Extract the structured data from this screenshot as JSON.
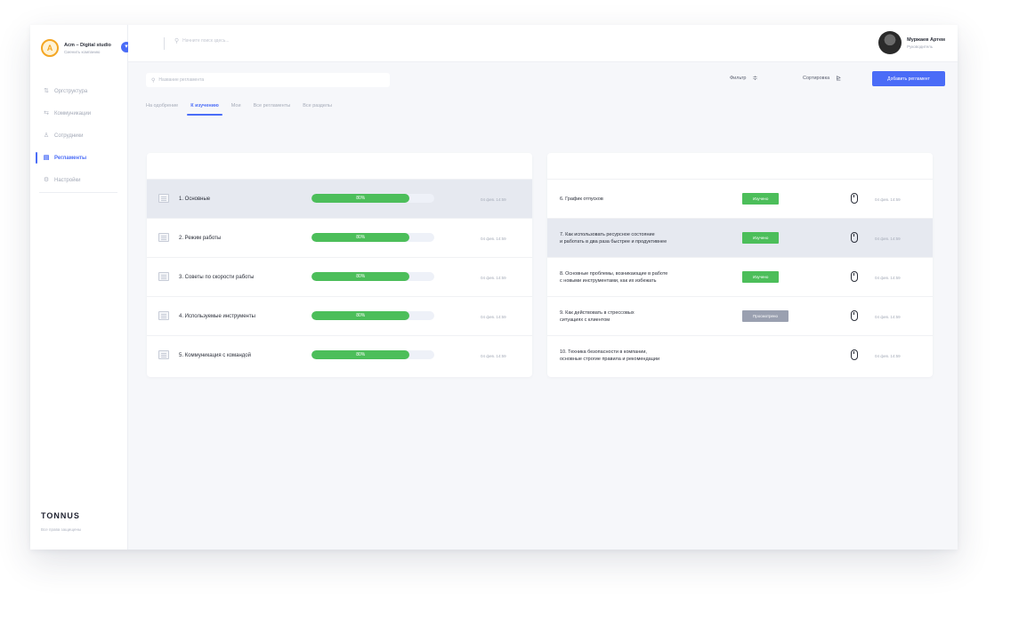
{
  "workspace": {
    "logo_letter": "A",
    "name": "Acm – Digital studio",
    "subtitle": "Сменить компанию",
    "toggle_icon": "chevron-down-icon"
  },
  "sidebar": {
    "items": [
      {
        "label": "Оргструктура",
        "icon": "org-structure-icon",
        "glyph": "⇅",
        "active": false
      },
      {
        "label": "Коммуникации",
        "icon": "communications-icon",
        "glyph": "⇆",
        "active": false
      },
      {
        "label": "Сотрудники",
        "icon": "employees-icon",
        "glyph": "♙",
        "active": false
      },
      {
        "label": "Регламенты",
        "icon": "regulations-icon",
        "glyph": "▤",
        "active": true
      },
      {
        "label": "Настройки",
        "icon": "settings-icon",
        "glyph": "⚙",
        "active": false
      }
    ],
    "brand": "TONNUS",
    "brand_sub": "Все права защищены"
  },
  "topbar": {
    "search_placeholder": "Начните поиск здесь...",
    "user_name": "Муржаев Артем",
    "user_role": "Руководитель"
  },
  "toolbar": {
    "search_placeholder": "Название регламента",
    "filter_label": "Фильтр",
    "sort_label": "Сортировка",
    "add_button": "Добавить регламент"
  },
  "tabs": [
    {
      "label": "На одобрение",
      "active": false
    },
    {
      "label": "К изучению",
      "active": true
    },
    {
      "label": "Мои",
      "active": false
    },
    {
      "label": "Все регламенты",
      "active": false
    },
    {
      "label": "Все разделы",
      "active": false
    }
  ],
  "documents": [
    {
      "title": "1. Основные",
      "progress_label": "80%",
      "progress": 80,
      "date": "04 фев. 14:59",
      "selected": true
    },
    {
      "title": "2. Режим работы",
      "progress_label": "80%",
      "progress": 80,
      "date": "04 фев. 14:59",
      "selected": false
    },
    {
      "title": "3. Советы по скорости работы",
      "progress_label": "80%",
      "progress": 80,
      "date": "04 фев. 14:59",
      "selected": false
    },
    {
      "title": "4. Используемые инструменты",
      "progress_label": "80%",
      "progress": 80,
      "date": "04 фев. 14:59",
      "selected": false
    },
    {
      "title": "5. Коммуникация с командой",
      "progress_label": "80%",
      "progress": 80,
      "date": "04 фев. 14:59",
      "selected": false
    }
  ],
  "tasks": [
    {
      "title": "6. График отпусков",
      "status": "Изучено",
      "status_color": "#4cbe5a",
      "date": "04 фев. 14:59",
      "selected": false
    },
    {
      "title": "7. Как использовать ресурсное состояние\nи работать в два раза быстрее и продуктивнее",
      "status": "Изучено",
      "status_color": "#4cbe5a",
      "date": "04 фев. 14:59",
      "selected": true
    },
    {
      "title": "8. Основные проблемы, возникающие в работе\nс новыми инструментами, как их избежать",
      "status": "Изучено",
      "status_color": "#4cbe5a",
      "date": "04 фев. 14:59",
      "selected": false
    },
    {
      "title": "9. Как действовать в стрессовых\nситуациях с клиентом",
      "status": "Просмотрено",
      "status_color": "#9aa0b0",
      "date": "04 фев. 14:59",
      "selected": false
    },
    {
      "title": "10. Техника безопасности в компании,\nосновные строгие правила и рекомендации",
      "status": "",
      "status_color": "",
      "date": "04 фев. 14:59",
      "selected": false
    }
  ],
  "colors": {
    "accent": "#4a6cf7",
    "success": "#4cbe5a",
    "muted": "#9aa0b0"
  }
}
